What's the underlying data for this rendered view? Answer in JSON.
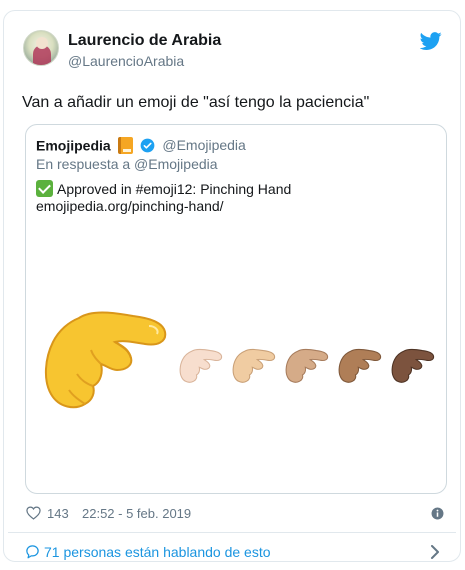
{
  "tweet": {
    "author": {
      "display_name": "Laurencio de Arabia",
      "handle": "@LaurencioArabia"
    },
    "text": "Van a añadir un emoji de \"así tengo la paciencia\"",
    "likes": "143",
    "timestamp": "22:52 - 5 feb. 2019",
    "footer_link": "71 personas están hablando de esto"
  },
  "quoted": {
    "name": "Emojipedia",
    "handle": "@Emojipedia",
    "reply_to": "En respuesta a @Emojipedia",
    "line1": "Approved in #emoji12: Pinching Hand",
    "line2": "emojipedia.org/pinching-hand/"
  },
  "icons": {
    "brand": "twitter-bird-icon",
    "verified": "verified-badge-icon",
    "like": "heart-icon",
    "info": "info-icon",
    "reply": "speech-bubble-icon",
    "more": "chevron-right-icon"
  },
  "colors": {
    "accent": "#1da1f2",
    "link": "#1b95e0",
    "text": "#14171a",
    "muted": "#657786",
    "border": "#e1e8ed",
    "skin_tones": [
      "#ffc83d",
      "#f7dece",
      "#f3d2a2",
      "#d5ab88",
      "#af7e57",
      "#7c533e"
    ]
  }
}
